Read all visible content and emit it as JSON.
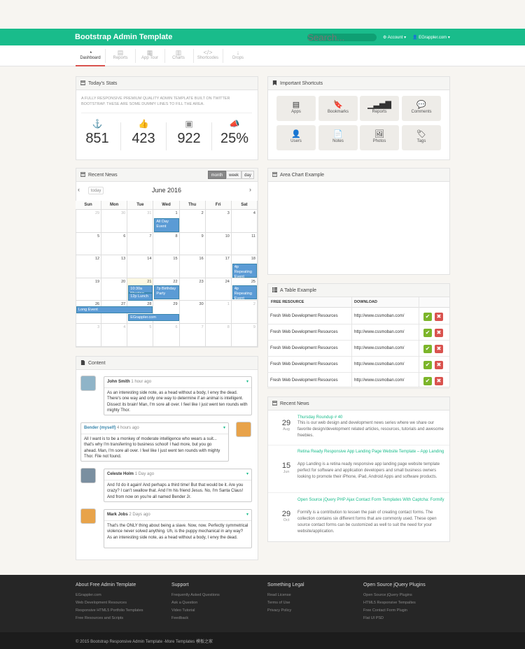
{
  "brand": "Bootstrap Admin Template",
  "search": {
    "placeholder": "Search..."
  },
  "topmenu": {
    "account": "Account",
    "user": "EGrappler.com"
  },
  "nav": [
    "Dashboard",
    "Reports",
    "App Tour",
    "Charts",
    "Shortcodes",
    "Drops"
  ],
  "stats": {
    "title": "Today's Stats",
    "intro": "A fully responsive premium quality admin template built on Twitter Bootstrap. These are some dummy lines to fill the area.",
    "items": [
      {
        "icon": "anchor-icon",
        "value": "851"
      },
      {
        "icon": "thumbs-up-icon",
        "value": "423"
      },
      {
        "icon": "twitter-icon",
        "value": "922"
      },
      {
        "icon": "bullhorn-icon",
        "value": "25%"
      }
    ]
  },
  "shortcuts": {
    "title": "Important Shortcuts",
    "items": [
      "Apps",
      "Bookmarks",
      "Reports",
      "Comments",
      "Users",
      "Notes",
      "Photos",
      "Tags"
    ]
  },
  "calendar": {
    "title": "Recent News",
    "views": [
      "month",
      "week",
      "day"
    ],
    "today": "today",
    "month": "June 2016",
    "days": [
      "Sun",
      "Mon",
      "Tue",
      "Wed",
      "Thu",
      "Fri",
      "Sat"
    ],
    "weeks": [
      [
        "29",
        "30",
        "31",
        "1",
        "2",
        "3",
        "4"
      ],
      [
        "5",
        "6",
        "7",
        "8",
        "9",
        "10",
        "11"
      ],
      [
        "12",
        "13",
        "14",
        "15",
        "16",
        "17",
        "18"
      ],
      [
        "19",
        "20",
        "21",
        "22",
        "23",
        "24",
        "25"
      ],
      [
        "26",
        "27",
        "28",
        "29",
        "30",
        "1",
        "2"
      ],
      [
        "3",
        "4",
        "5",
        "6",
        "7",
        "8",
        "9"
      ]
    ],
    "events": {
      "allday": "All Day Event",
      "rep1": "4p Repeating Event",
      "meet": "10:30a Meeting",
      "lunch": "12p Lunch",
      "bday": "7p Birthday Party",
      "rep2": "4p Repeating Event",
      "long": "Long Event",
      "eg": "EGrappler.com"
    }
  },
  "areachart": {
    "title": "Area Chart Example"
  },
  "table": {
    "title": "A Table Example",
    "headers": [
      "FREE RESOURCE",
      "DOWNLOAD"
    ],
    "rows": [
      [
        "Fresh Web Development Resources",
        "http://www.cssmoban.com/"
      ],
      [
        "Fresh Web Development Resources",
        "http://www.cssmoban.com/"
      ],
      [
        "Fresh Web Development Resources",
        "http://www.cssmoban.com/"
      ],
      [
        "Fresh Web Development Resources",
        "http://www.cssmoban.com/"
      ],
      [
        "Fresh Web Development Resources",
        "http://www.cssmoban.com/"
      ]
    ],
    "ok": "✔",
    "x": "✖"
  },
  "content": {
    "title": "Content",
    "comments": [
      {
        "name": "John Smith",
        "time": "1 hour ago",
        "text": "As an interesting side note, as a head without a body, I envy the dead. There's one way and only one way to determine if an animal is intelligent. Dissect its brain! Man, I'm sore all over. I feel like I just went ten rounds with mighty Thor."
      },
      {
        "name": "Bender (myself)",
        "time": "4 hours ago",
        "text": "All I want is to be a monkey of moderate intelligence who wears a suit... that's why I'm transferring to business school! I had more, but you go ahead. Man, I'm sore all over. I feel like I just went ten rounds with mighty Thor. File not found."
      },
      {
        "name": "Celeste Holm",
        "time": "1 Day ago",
        "text": "And I'd do it again! And perhaps a third time! But that would be it. Are you crazy? I can't swallow that. And I'm his friend Jesus. No, I'm Santa Claus! And from now on you're all named Bender Jr."
      },
      {
        "name": "Mark Jobs",
        "time": "2 Days ago",
        "text": "That's the ONLY thing about being a slave. Now, now. Perfectly symmetrical violence never solved anything. Uh, is the puppy mechanical in any way? As an interesting side note, as a head without a body, I envy the dead."
      }
    ]
  },
  "recentnews": {
    "title": "Recent News",
    "items": [
      {
        "day": "29",
        "mon": "Aug",
        "title": "Thursday Roundup # 40",
        "text": "This is our web design and development news series where we share our favorite design/development related articles, resources, tutorials and awesome freebies."
      },
      {
        "day": "15",
        "mon": "Jun",
        "title": "Retina Ready Responsive App Landing Page Website Template – App Landing",
        "text": "App Landing is a retina ready responsive app landing page website template perfect for software and application developers and small business owners looking to promote their iPhone, iPad, Android Apps and software products."
      },
      {
        "day": "29",
        "mon": "Oct",
        "title": "Open Source jQuery PHP Ajax Contact Form Templates With Captcha: Formify",
        "text": "Formify is a contribution to lessen the pain of creating contact forms. The collection contains six different forms that are commonly used. These open source contact forms can be customized as well to suit the need for your website/application."
      }
    ]
  },
  "footer": {
    "cols": [
      {
        "title": "About Free Admin Template",
        "links": [
          "EGrappler.com",
          "Web Development Resources",
          "Responsive HTML5 Portfolio Templates",
          "Free Resources and Scripts"
        ]
      },
      {
        "title": "Support",
        "links": [
          "Frequently Asked Questions",
          "Ask a Question",
          "Video Tutorial",
          "Feedback"
        ]
      },
      {
        "title": "Something Legal",
        "links": [
          "Read License",
          "Terms of Use",
          "Privacy Policy"
        ]
      },
      {
        "title": "Open Source jQuery Plugins",
        "links": [
          "Open Source jQuery Plugins",
          "HTML5 Responsive Tempaltes",
          "Free Contact Form Plugin",
          "Flat UI PSD"
        ]
      }
    ],
    "copyright": "© 2015 Bootstrap Responsive Admin Template -More Templates 模板之家"
  },
  "colors": {
    "brand": "#19bc8b",
    "event": "#5b9bd5"
  }
}
